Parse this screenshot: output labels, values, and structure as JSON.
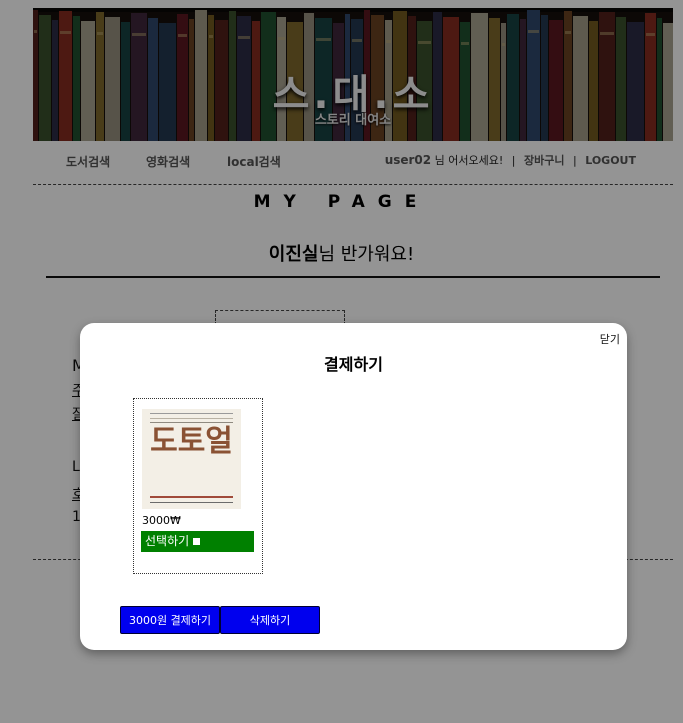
{
  "header": {
    "logo": "스.대.소",
    "tagline": "스토리 대여소"
  },
  "nav": {
    "book_search": "도서검색",
    "movie_search": "영화검색",
    "local_search": "local검색"
  },
  "user": {
    "id": "user02",
    "greeting": "님 어서오세요!",
    "cart": "장바구니",
    "logout": "LOGOUT"
  },
  "page": {
    "heading": "MY PAGE",
    "user_name": "이진실",
    "welcome_suffix": "님 반가워요!",
    "ghost_lines": [
      "M",
      "주",
      "잘",
      "L",
      "호",
      "1"
    ]
  },
  "modal": {
    "close_label": "닫기",
    "title": "결제하기",
    "item": {
      "poster_title": "도토얼",
      "price": "3000₩",
      "select_label": "선택하기"
    },
    "pay_button": "3000원 결제하기",
    "delete_button": "삭제하기"
  },
  "colors": {
    "select_bar": "#008000",
    "button": "#0000ee",
    "overlay": "rgba(0,0,0,0.42)"
  }
}
